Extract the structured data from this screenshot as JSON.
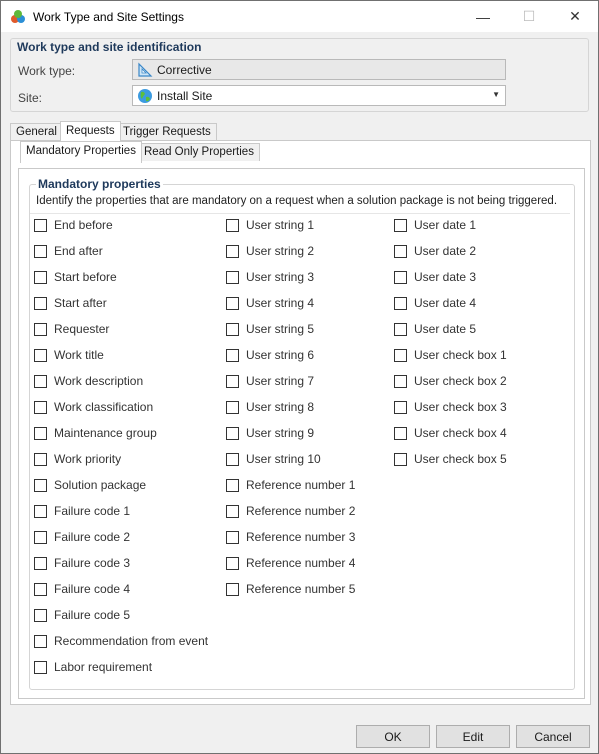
{
  "window": {
    "title": "Work Type and Site Settings",
    "controls": {
      "minimize": "—",
      "maximize": "☐",
      "close": "✕"
    }
  },
  "identification": {
    "title": "Work type and site identification",
    "work_type_label": "Work type:",
    "work_type_value": "Corrective",
    "work_type_icon": "triangle-ruler-icon",
    "site_label": "Site:",
    "site_value": "Install Site",
    "site_icon": "globe-icon"
  },
  "tabs": [
    {
      "label": "General",
      "active": false
    },
    {
      "label": "Requests",
      "active": true
    },
    {
      "label": "Trigger Requests",
      "active": false
    }
  ],
  "inner_tabs": [
    {
      "label": "Mandatory Properties",
      "active": true
    },
    {
      "label": "Read Only Properties",
      "active": false
    }
  ],
  "mandatory": {
    "title": "Mandatory properties",
    "description": "Identify the properties that are mandatory on a request when a solution package is not being triggered.",
    "columns": [
      [
        "End before",
        "End after",
        "Start before",
        "Start after",
        "Requester",
        "Work title",
        "Work description",
        "Work classification",
        "Maintenance group",
        "Work priority",
        "Solution package",
        "Failure code 1",
        "Failure code 2",
        "Failure code 3",
        "Failure code 4",
        "Failure code 5",
        "Recommendation from event",
        "Labor requirement"
      ],
      [
        "User string 1",
        "User string 2",
        "User string 3",
        "User string 4",
        "User string 5",
        "User string 6",
        "User string 7",
        "User string 8",
        "User string 9",
        "User string 10",
        "Reference number 1",
        "Reference number 2",
        "Reference number 3",
        "Reference number 4",
        "Reference number 5"
      ],
      [
        "User date 1",
        "User date 2",
        "User date 3",
        "User date 4",
        "User date 5",
        "User check box 1",
        "User check box 2",
        "User check box 3",
        "User check box 4",
        "User check box 5"
      ]
    ]
  },
  "buttons": {
    "ok": "OK",
    "edit": "Edit",
    "cancel": "Cancel"
  },
  "colors": {
    "group_title": "#1e395b",
    "window_bg": "#f0f0f0"
  }
}
